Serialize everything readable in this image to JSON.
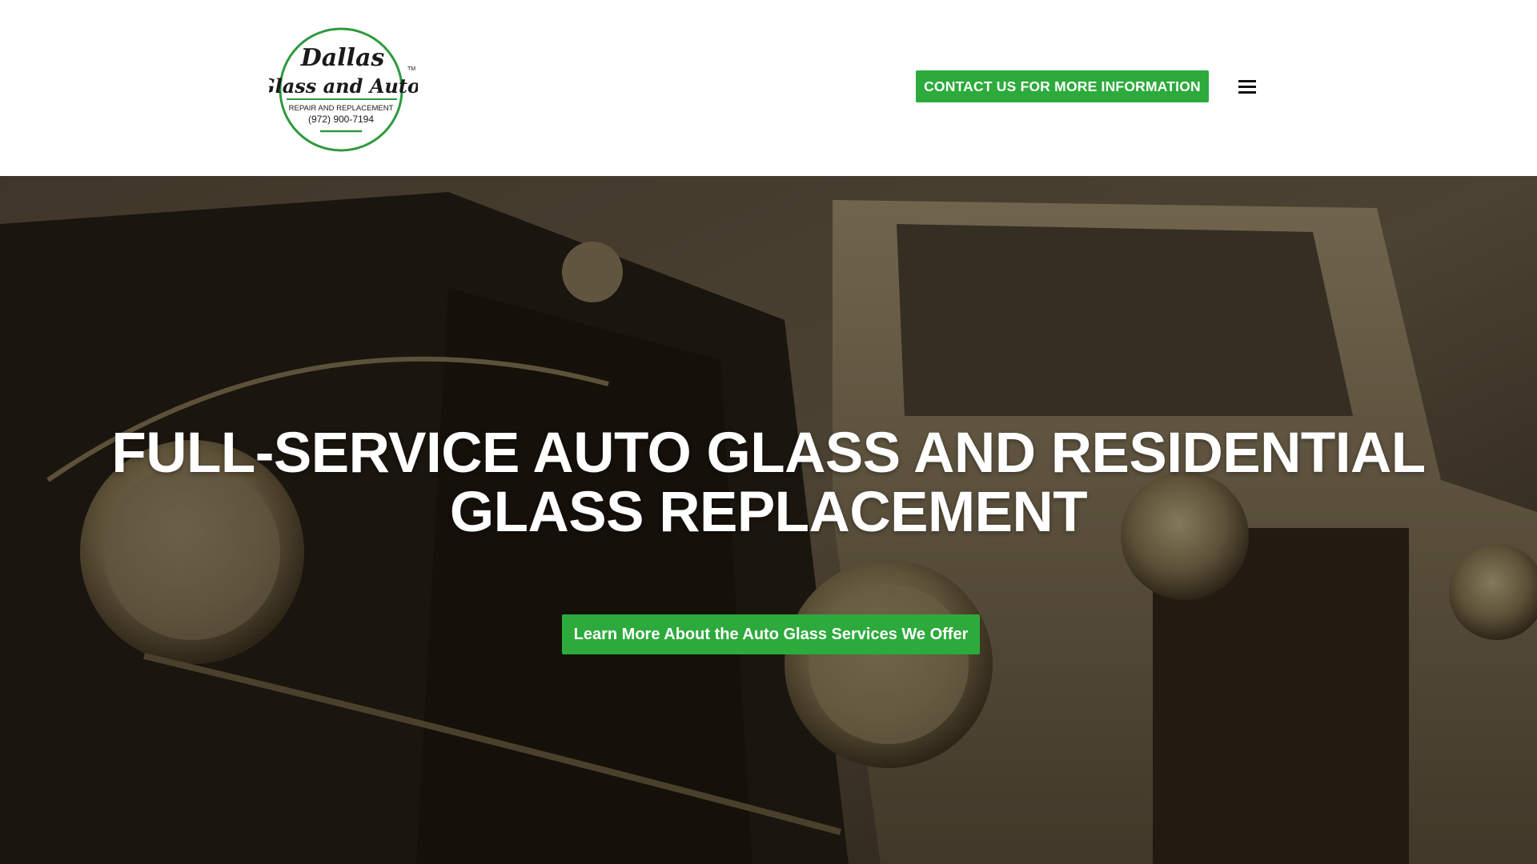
{
  "header": {
    "logo": {
      "line1": "Dallas",
      "line2": "Glass and Auto",
      "trademark": "TM",
      "tagline": "REPAIR AND REPLACEMENT",
      "phone": "(972) 900-7194"
    },
    "contact_button_label": "CONTACT US FOR MORE INFORMATION",
    "menu_icon": "hamburger-menu-icon"
  },
  "hero": {
    "title": "FULL-SERVICE AUTO GLASS AND RESIDENTIAL GLASS REPLACEMENT",
    "cta_label": "Learn More About the Auto Glass Services We Offer",
    "background": "vintage-cars-photo"
  },
  "colors": {
    "accent_green": "#2daa3c",
    "logo_green": "#2e9a3e",
    "text_dark": "#111111",
    "white": "#ffffff"
  }
}
